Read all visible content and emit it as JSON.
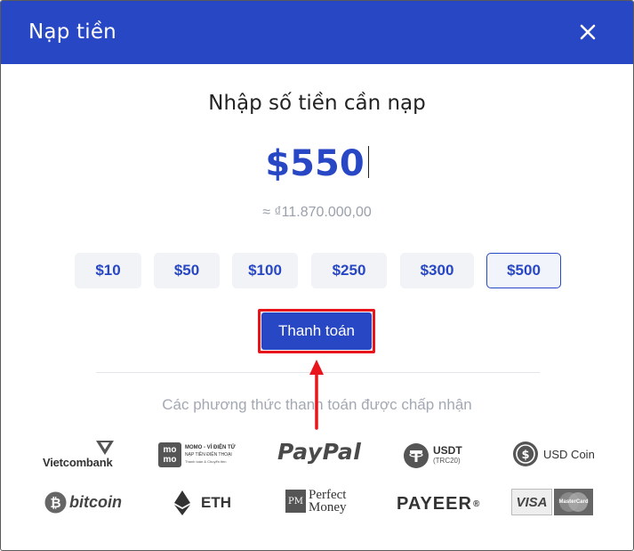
{
  "dialog": {
    "title": "Nạp tiền",
    "close_icon": "close-icon"
  },
  "form": {
    "heading": "Nhập số tiền cần nạp",
    "amount": "$550",
    "converted": "≈ ₫11.870.000,00"
  },
  "presets": [
    {
      "label": "$10",
      "selected": false
    },
    {
      "label": "$50",
      "selected": false
    },
    {
      "label": "$100",
      "selected": false
    },
    {
      "label": "$250",
      "selected": false
    },
    {
      "label": "$300",
      "selected": false
    },
    {
      "label": "$500",
      "selected": true
    }
  ],
  "pay_button": {
    "label": "Thanh toán",
    "highlight_color": "#e8151d"
  },
  "methods": {
    "caption": "Các phương thức thanh toán được chấp nhận",
    "logos": {
      "vietcombank": "Vietcombank",
      "momo_title": "MOMO - VÍ ĐIỆN TỬ",
      "momo_sub": "NẠP TIỀN ĐIỆN THOẠI",
      "momo_sub2": "Thanh toán & Chuyển tiền",
      "momo_mark_top": "mo",
      "momo_mark_bottom": "mo",
      "paypal": "PayPal",
      "usdt": "USDT",
      "usdt_sub": "(TRC20)",
      "usdc": "USD Coin",
      "bitcoin": "bitcoin",
      "eth": "ETH",
      "pm_mark": "PM",
      "pm_line1": "Perfect",
      "pm_line2": "Money",
      "payeer": "PAYEER",
      "visa": "VISA",
      "mastercard": "MasterCard"
    }
  },
  "colors": {
    "brand": "#2747c4",
    "annotation": "#e8151d"
  }
}
